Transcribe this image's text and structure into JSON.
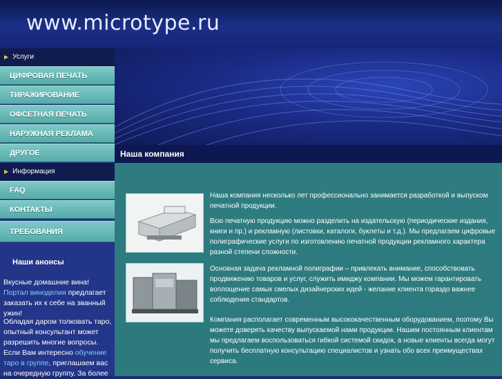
{
  "site_title": "www.microtype.ru",
  "sidebar": {
    "section1": "Услуги",
    "services": [
      "ЦИФРОВАЯ ПЕЧАТЬ",
      "ТИРАЖИРОВАНИЕ",
      "ОФСЕТНАЯ ПЕЧАТЬ",
      "НАРУЖНАЯ РЕКЛАМА",
      "ДРУГОЕ"
    ],
    "section2": "Информация",
    "info": [
      "FAQ",
      "КОНТАКТЫ",
      "ТРЕБОВАНИЯ"
    ],
    "anons_title": "Наши анонсы",
    "anons1": {
      "pre": "Вкусные домашние вина! ",
      "link": "Портал виноделия",
      "post": " предлагает заказать их к себе на званный ужин!"
    },
    "anons2": {
      "pre": "Обладая даром толковать таро, опытный консультант может разрешить многие вопросы. Если Вам интересно ",
      "link": "обучение таро в группе",
      "post": ", приглашаем вас на очередную группу. За более"
    }
  },
  "content": {
    "heading": "Наша компания",
    "p1": "Наша компания несколько лет профессионально занимается разработкой и выпуском печатной продукции.",
    "p2": "Всю печатную продукцию можно разделить на издательскую  (периодические издания, книги и пр.) и рекламную  (листовки, каталоги, буклеты и т.д.). Мы предлагаем цифровые полиграфические услуги по изготовлению печатной продукции рекламного характера разной степени сложности.",
    "p3": "Основная задача рекламной полиграфии  – привлекать внимание, способствовать продвижению товаров и услуг, служить имиджу компании. Мы можем гарантировать воплощение самых смелых дизайнерских идей - желание клиента гораздо важнее соблюдения стандартов.",
    "p4": "Компания располагает современным высококачественным оборудованием, поэтому Вы можете доверять качеству выпускаемой нами продукции. Нашим постоянным клиентам мы предлагаем воспользоваться гибкой системой скидок, а новые клиенты всегда могут получить бесплатную консультацию специалистов и узнать обо всех преимуществах сервиса."
  },
  "colors": {
    "nav": "#6bbdbb",
    "content_bg": "#2e7c80",
    "dark_bar": "#0d1850",
    "link": "#7fd0ff"
  }
}
